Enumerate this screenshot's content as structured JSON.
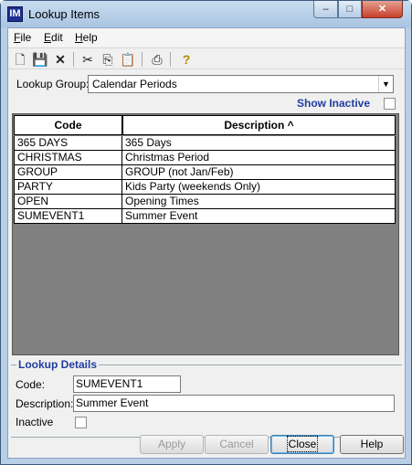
{
  "window": {
    "title": "Lookup Items",
    "app_icon": "IM"
  },
  "caption_buttons": {
    "minimize": "–",
    "maximize": "□",
    "close": "✕"
  },
  "menu": [
    {
      "label": "File",
      "key": "F",
      "rest": "ile"
    },
    {
      "label": "Edit",
      "key": "E",
      "rest": "dit"
    },
    {
      "label": "Help",
      "key": "H",
      "rest": "elp"
    }
  ],
  "toolbar": [
    "new-icon",
    "save-icon",
    "delete-icon",
    "cut-icon",
    "copy-icon",
    "paste-icon",
    "print-icon",
    "help-icon"
  ],
  "lookup_group": {
    "label": "Lookup Group:",
    "value": "Calendar Periods"
  },
  "show_inactive": {
    "label": "Show Inactive",
    "checked": false
  },
  "grid": {
    "columns": [
      "Code",
      "Description ^"
    ],
    "rows": [
      {
        "code": "365 DAYS",
        "description": "365 Days"
      },
      {
        "code": "CHRISTMAS",
        "description": "Christmas Period"
      },
      {
        "code": "GROUP",
        "description": "GROUP (not Jan/Feb)"
      },
      {
        "code": "PARTY",
        "description": "Kids Party (weekends Only)"
      },
      {
        "code": "OPEN",
        "description": "Opening Times"
      },
      {
        "code": "SUMEVENT1",
        "description": "Summer Event"
      }
    ]
  },
  "details": {
    "title": "Lookup Details",
    "code_label": "Code:",
    "code_value": "SUMEVENT1",
    "description_label": "Description:",
    "description_value": "Summer Event",
    "inactive_label": "Inactive",
    "inactive_checked": false
  },
  "buttons": {
    "apply": "Apply",
    "cancel": "Cancel",
    "close": "Close",
    "help": "Help"
  },
  "colors": {
    "accent_blue": "#1f3da0",
    "grid_bg": "#808080",
    "titlebar": "#b9cfe6"
  }
}
